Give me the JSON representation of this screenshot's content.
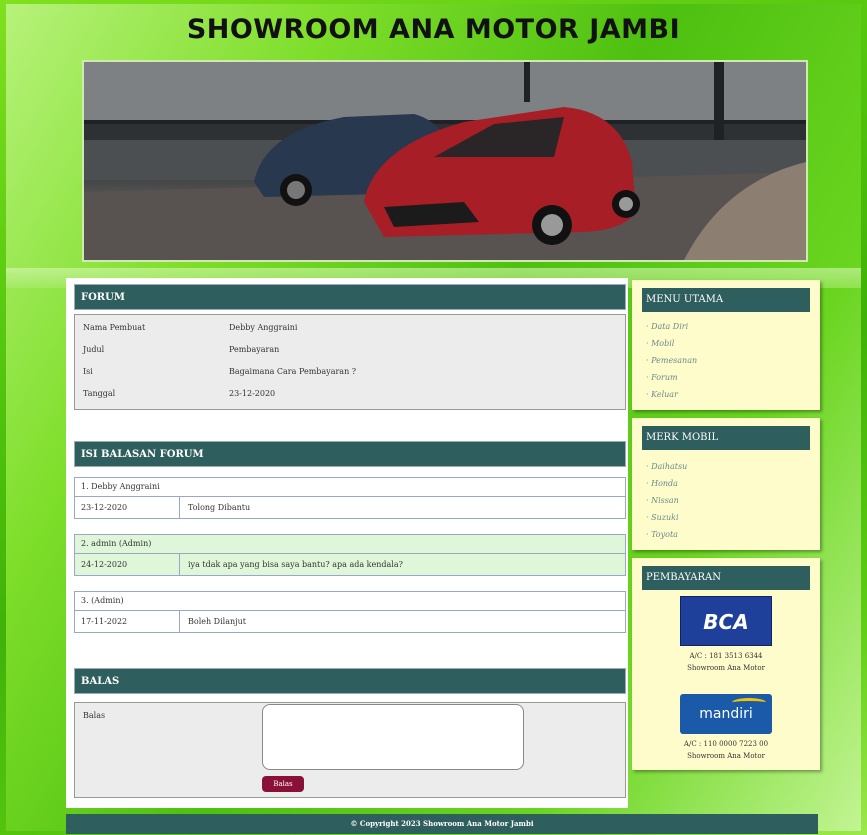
{
  "site_title": "SHOWROOM ANA MOTOR JAMBI",
  "forum": {
    "heading": "FORUM",
    "rows": [
      {
        "label": "Nama Pembuat",
        "value": "Debby Anggraini"
      },
      {
        "label": "Judul",
        "value": "Pembayaran"
      },
      {
        "label": "Isi",
        "value": "Bagaimana Cara Pembayaran ?"
      },
      {
        "label": "Tanggal",
        "value": "23-12-2020"
      }
    ]
  },
  "replies": {
    "heading": "ISI BALASAN FORUM",
    "items": [
      {
        "header": "1. Debby Anggraini",
        "date": "23-12-2020",
        "text": "Tolong Dibantu"
      },
      {
        "header": "2. admin (Admin)",
        "date": "24-12-2020",
        "text": "iya tdak apa yang bisa saya bantu? apa ada kendala?"
      },
      {
        "header": "3. (Admin)",
        "date": "17-11-2022",
        "text": "Boleh Dilanjut"
      }
    ]
  },
  "reply_form": {
    "heading": "BALAS",
    "label": "Balas",
    "button": "Balas"
  },
  "sidebar": {
    "menu_utama": {
      "heading": "MENU UTAMA",
      "items": [
        "Data Diri",
        "Mobil",
        "Pemesanan",
        "Forum",
        "Keluar"
      ]
    },
    "merk_mobil": {
      "heading": "MERK MOBIL",
      "items": [
        "Daihatsu",
        "Honda",
        "Nissan",
        "Suzuki",
        "Toyota"
      ]
    },
    "pembayaran": {
      "heading": "PEMBAYARAN",
      "bca_logo": "BCA",
      "bca_account": "A/C : 181 3513 6344",
      "bca_name": "Showroom Ana Motor",
      "mandiri_logo": "mandiri",
      "mandiri_account": "A/C : 110 0000 7223 00",
      "mandiri_name": "Showroom Ana Motor"
    }
  },
  "footer": "© Copyright 2023 Showroom Ana Motor Jambi",
  "colors": {
    "header_bar": "#2f5e5e",
    "background": "#4ec010",
    "sidebar": "#fffccc",
    "button": "#8b1038"
  }
}
